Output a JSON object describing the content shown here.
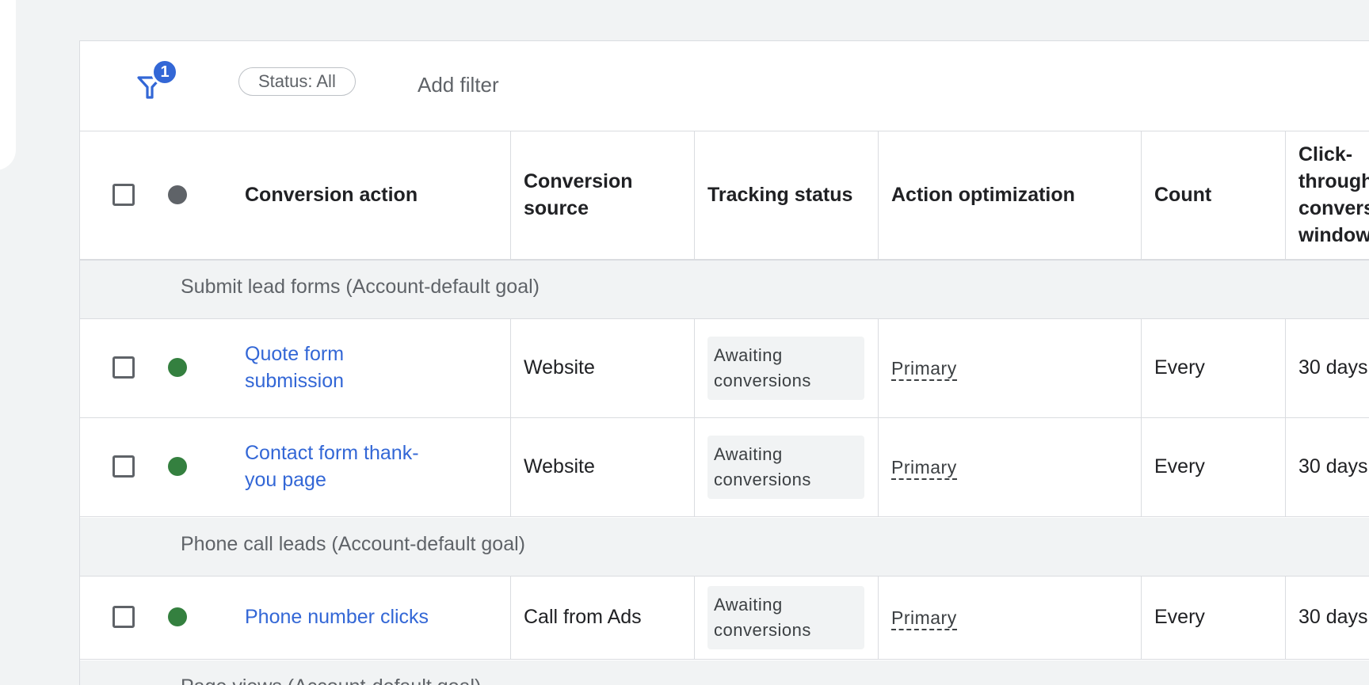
{
  "filter_bar": {
    "filter_count": "1",
    "status_chip": "Status: All",
    "add_filter": "Add filter"
  },
  "columns": {
    "conversion_action": "Conversion action",
    "conversion_source": "Conversion source",
    "tracking_status": "Tracking status",
    "action_optimization": "Action optimization",
    "count": "Count",
    "click_through": "Click-through conversion window"
  },
  "column_head_lines": {
    "conversion_source": [
      "Conversion",
      "source"
    ],
    "click_through": [
      "Click-",
      "through",
      "convers",
      "window"
    ]
  },
  "groups": [
    {
      "title": "Submit lead forms (Account-default goal)",
      "rows": [
        {
          "action_lines": [
            "Quote form",
            "submission"
          ],
          "source": "Website",
          "tracking_lines": [
            "Awaiting",
            "conversions"
          ],
          "optimization": "Primary",
          "count": "Every",
          "window": "30 days"
        },
        {
          "action_lines": [
            "Contact form thank-",
            "you page"
          ],
          "source": "Website",
          "tracking_lines": [
            "Awaiting",
            "conversions"
          ],
          "optimization": "Primary",
          "count": "Every",
          "window": "30 days"
        }
      ]
    },
    {
      "title": "Phone call leads (Account-default goal)",
      "rows": [
        {
          "action_lines": [
            "Phone number clicks"
          ],
          "source": "Call from Ads",
          "tracking_lines": [
            "Awaiting",
            "conversions"
          ],
          "optimization": "Primary",
          "count": "Every",
          "window": "30 days"
        }
      ]
    },
    {
      "title": "Page views (Account-default goal)",
      "rows": []
    }
  ],
  "colors": {
    "link": "#3367d6",
    "status_enabled": "#34803f",
    "status_header": "#5f6368",
    "badge_bg": "#f1f3f4"
  },
  "icons": {
    "filter": "filter-funnel-icon",
    "status_dot": "status-dot-icon",
    "checkbox": "checkbox-icon"
  }
}
